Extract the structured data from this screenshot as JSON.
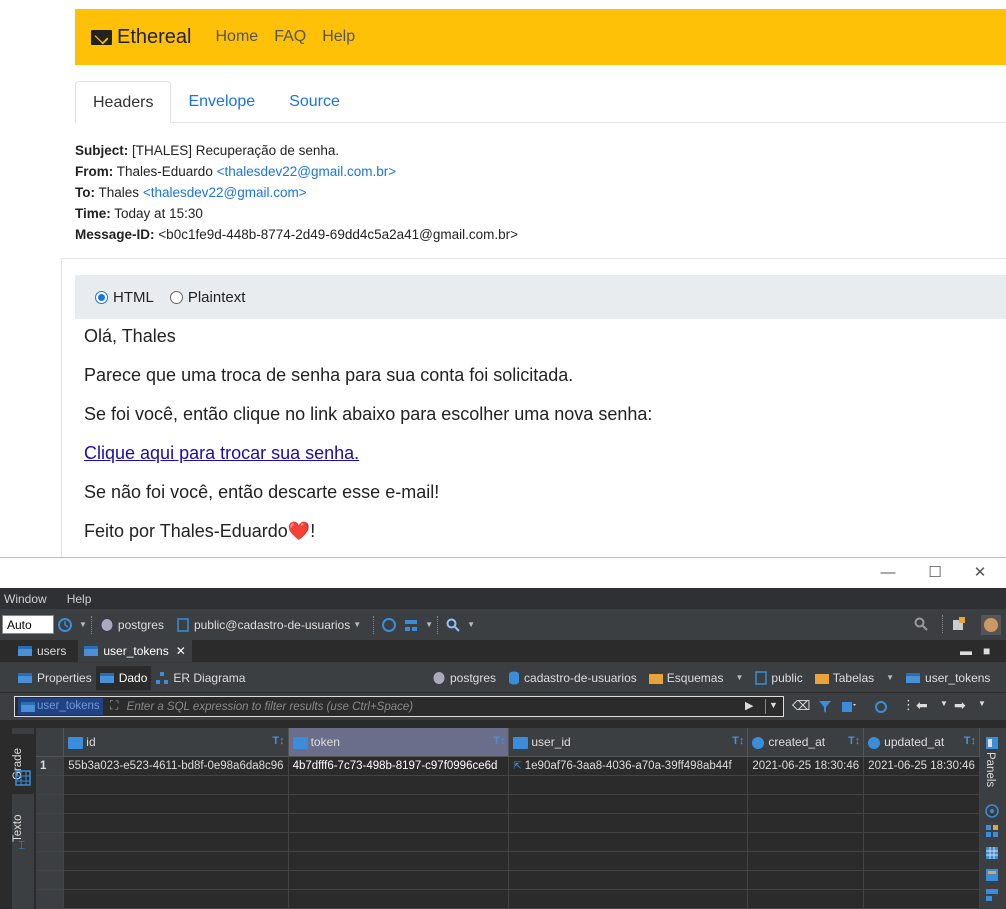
{
  "ethereal": {
    "brand": "Ethereal",
    "nav": [
      "Home",
      "FAQ",
      "Help"
    ],
    "tabs": [
      "Headers",
      "Envelope",
      "Source"
    ],
    "headers": {
      "subject_label": "Subject:",
      "subject": "[THALES] Recuperação de senha.",
      "from_label": "From:",
      "from_name": "Thales-Eduardo",
      "from_email": "<thalesdev22@gmail.com.br>",
      "to_label": "To:",
      "to_name": "Thales",
      "to_email": "<thalesdev22@gmail.com>",
      "time_label": "Time:",
      "time": "Today at 15:30",
      "msgid_label": "Message-ID:",
      "msgid": "<b0c1fe9d-448b-8774-2d49-69dd4c5a2a41@gmail.com.br>"
    },
    "format": {
      "html": "HTML",
      "plaintext": "Plaintext",
      "selected": "HTML"
    },
    "body": {
      "greeting": "Olá, Thales",
      "line1": "Parece que uma troca de senha para sua conta foi solicitada.",
      "line2": "Se foi você, então clique no link abaixo para escolher uma nova senha:",
      "link": "Clique aqui para trocar sua senha.",
      "line3": "Se não foi você, então descarte esse e-mail!",
      "signature": "Feito por Thales-Eduardo❤️!"
    }
  },
  "dbeaver": {
    "menu": [
      "Window",
      "Help"
    ],
    "toolbar": {
      "commit_mode": "Auto",
      "connection": "postgres",
      "schema": "public@cadastro-de-usuarios"
    },
    "editor_tabs": [
      "users",
      "user_tokens"
    ],
    "sub_tabs": [
      "Properties",
      "Dado",
      "ER Diagrama"
    ],
    "breadcrumb": [
      "postgres",
      "cadastro-de-usuarios",
      "Esquemas",
      "public",
      "Tabelas",
      "user_tokens"
    ],
    "filter": {
      "tag": "user_tokens",
      "placeholder": "Enter a SQL expression to filter results (use Ctrl+Space)"
    },
    "side_tabs": [
      "Grade",
      "Texto"
    ],
    "right_panel_label": "Panels",
    "grid": {
      "columns": [
        "id",
        "token",
        "user_id",
        "created_at",
        "updated_at"
      ],
      "rows": [
        {
          "num": "1",
          "id": "55b3a023-e523-4611-bd8f-0e98a6da8c96",
          "token": "4b7dfff6-7c73-498b-8197-c97f0996ce6d",
          "user_id": "1e90af76-3aa8-4036-a70a-39ff498ab44f",
          "created_at": "2021-06-25 18:30:46",
          "updated_at": "2021-06-25 18:30:46"
        }
      ]
    },
    "colors": {
      "accent": "#4a90d9",
      "bg": "#2b2b2b",
      "panel": "#3c3f41"
    }
  }
}
